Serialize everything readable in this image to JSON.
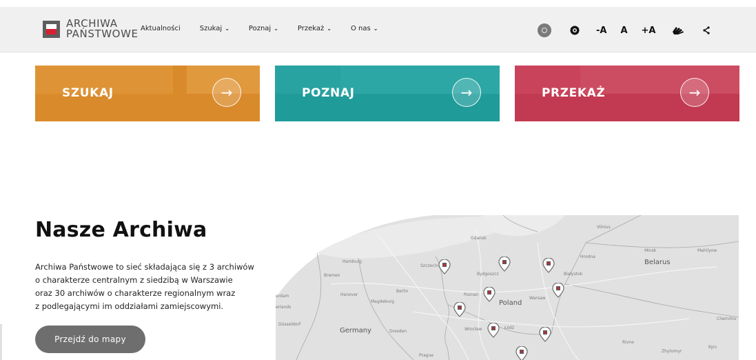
{
  "header": {
    "logo": {
      "line1": "ARCHIWA",
      "line2": "PAŃSTWOWE"
    },
    "nav": [
      {
        "label": "Aktualności",
        "has_dropdown": false
      },
      {
        "label": "Szukaj",
        "has_dropdown": true
      },
      {
        "label": "Poznaj",
        "has_dropdown": true
      },
      {
        "label": "Przekaż",
        "has_dropdown": true
      },
      {
        "label": "O nas",
        "has_dropdown": true
      }
    ],
    "tools": {
      "search_icon": "search-icon",
      "contrast_icon": "eye-icon",
      "font_smaller": "-A",
      "font_normal": "A",
      "font_larger": "+A",
      "sign_language_icon": "sign-language-icon",
      "share_icon": "share-icon"
    }
  },
  "tiles": [
    {
      "label": "SZUKAJ",
      "color": "#d98a2b",
      "arrow_icon": "arrow-right-icon"
    },
    {
      "label": "POZNAJ",
      "color": "#1f9b9a",
      "arrow_icon": "arrow-right-icon"
    },
    {
      "label": "PRZEKAŻ",
      "color": "#c23a51",
      "arrow_icon": "arrow-right-icon"
    }
  ],
  "archives": {
    "title": "Nasze Archiwa",
    "description_lines": [
      "Archiwa Państwowe to sieć składająca się z 3 archiwów",
      "o charakterze centralnym z siedzibą w Warszawie",
      "oraz 30 archiwów o charakterze regionalnym wraz",
      "z podlegającymi im oddziałami zamiejscowymi."
    ],
    "map_button": "Przejdź do mapy"
  },
  "map": {
    "labels": {
      "vilnius": "Vilnius",
      "gdansk": "Gdańsk",
      "minsk": "Minsk",
      "mahilyow": "Mahilyow",
      "belarus": "Belarus",
      "hrodna": "Hrodna",
      "hamburg": "Hamburg",
      "szczecin": "Szczecin",
      "bydgoszcz": "Bydgoszcz",
      "bialystok": "Białystok",
      "bremen": "Bremen",
      "berlin": "Berlin",
      "hanover": "Hanover",
      "poznan": "Poznań",
      "warsaw": "Warsaw",
      "magdeburg": "Magdeburg",
      "poland": "Poland",
      "erdam": "erdam",
      "erlands": "erlands",
      "dusseldorf": "Düsseldorf",
      "germany": "Germany",
      "dresden": "Dresden",
      "wroclaw": "Wrocław",
      "lodz": "Łódź",
      "chernihiv": "Chernihiv",
      "rivne": "Rivne",
      "kyiv": "Kyiv",
      "zhytomyr": "Zhytomyr",
      "prague": "Prague"
    },
    "pin_icon": "archive-pin-icon"
  },
  "colors": {
    "accent_red": "#d6202f",
    "header_bg": "#f0f0f0",
    "button_gray": "#6e6e6e"
  }
}
